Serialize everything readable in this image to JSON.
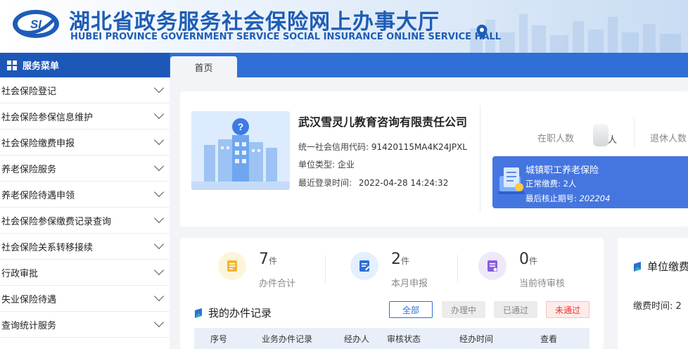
{
  "header": {
    "logo_text": "SI",
    "title_cn": "湖北省政务服务社会保险网上办事大厅",
    "title_en": "HUBEI PROVINCE GOVERNMENT SERVICE SOCIAL INSURANCE ONLINE SERVICE HALL"
  },
  "nav": {
    "menu_title": "服务菜单",
    "home_tab": "首页"
  },
  "sidebar": {
    "items": [
      {
        "label": "社会保险登记"
      },
      {
        "label": "社会保险参保信息维护"
      },
      {
        "label": "社会保险缴费申报"
      },
      {
        "label": "养老保险服务"
      },
      {
        "label": "养老保险待遇申领"
      },
      {
        "label": "社会保险参保缴费记录查询"
      },
      {
        "label": "社会保险关系转移接续"
      },
      {
        "label": "行政审批"
      },
      {
        "label": "失业保险待遇"
      },
      {
        "label": "查询统计服务"
      }
    ]
  },
  "company": {
    "name": "武汉雪灵儿教育咨询有限责任公司",
    "credit_label": "统一社会信用代码:",
    "credit_code": "91420115MA4K24JPXL",
    "type_label": "单位类型:",
    "type": "企业",
    "login_label": "最近登录时间:",
    "login_time": "2022-04-28 14:24:32",
    "employees_label": "在职人数",
    "employees_unit": "人",
    "retirees_label": "退休人数"
  },
  "pension": {
    "title": "城镇职工养老保险",
    "normal_label": "正常缴费:",
    "normal_value": "2人",
    "period_label": "最后核止期号:",
    "period_value": "202204"
  },
  "stats": [
    {
      "num": "7",
      "unit": "件",
      "label": "办件合计",
      "icon": "document-icon",
      "bg": "#fdf4dc",
      "fg": "#f2b632"
    },
    {
      "num": "2",
      "unit": "件",
      "label": "本月申报",
      "icon": "edit-document-icon",
      "bg": "#e4efff",
      "fg": "#2f6fd6"
    },
    {
      "num": "0",
      "unit": "件",
      "label": "当前待审核",
      "icon": "review-icon",
      "bg": "#efe8fb",
      "fg": "#8a5ce0"
    }
  ],
  "records": {
    "title": "我的办件记录",
    "filters": {
      "all": "全部",
      "processing": "办理中",
      "passed": "已通过",
      "failed": "未通过"
    },
    "columns": [
      "序号",
      "业务办件记录",
      "经办人",
      "审核状态",
      "经办时间",
      "查看"
    ]
  },
  "right_card": {
    "title": "单位缴费",
    "line": "缴费时间:  2"
  },
  "colors": {
    "primary": "#2f6fd6",
    "menu_dark": "#1d57b8",
    "pension_card": "#4576e0",
    "danger": "#e0372f"
  }
}
